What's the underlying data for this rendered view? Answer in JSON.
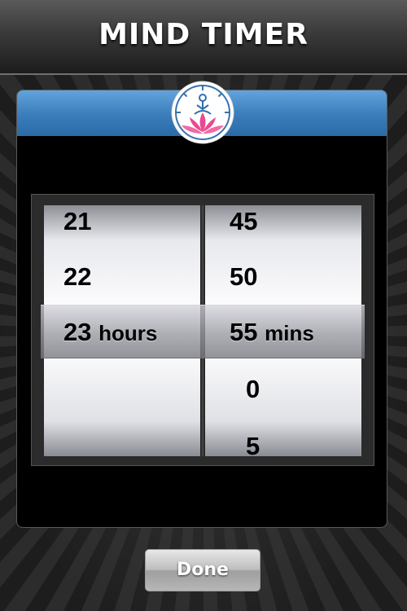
{
  "app": {
    "title": "MIND TIMER"
  },
  "logo": {
    "icon": "meditation-lotus-clock-icon",
    "colors": {
      "ring": "#ffffff",
      "lotus": "#e84a8f",
      "figure": "#2f6fae"
    }
  },
  "picker": {
    "hours": {
      "above": [
        "21",
        "22"
      ],
      "selected": "23",
      "unit": "hours",
      "below": []
    },
    "mins": {
      "above": [
        "45",
        "50"
      ],
      "selected": "55",
      "unit": "mins",
      "below": [
        "0",
        "5"
      ]
    }
  },
  "done_button": {
    "label": "Done"
  },
  "colors": {
    "header_blue": "#3c7fbc",
    "panel_bg": "#000000",
    "title_text": "#ffffff"
  }
}
